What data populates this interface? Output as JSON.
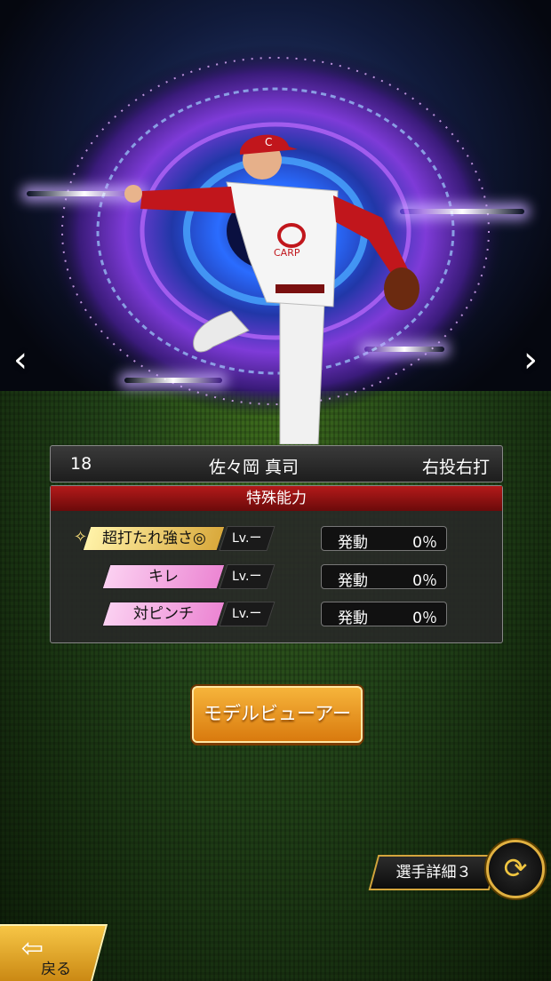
{
  "player": {
    "number": "18",
    "name": "佐々岡 真司",
    "throw_bat": "右投右打",
    "cap_logo": "C",
    "jersey_text": "CARP"
  },
  "abilities": {
    "header": "特殊能力",
    "items": [
      {
        "name": "超打たれ強さ◎",
        "prefix_icon": "sparkle-icon",
        "level": "Lv.ー",
        "status": "発動",
        "percent": "0％",
        "color": "#e9c45a"
      },
      {
        "name": "キレ",
        "prefix_icon": "",
        "level": "Lv.ー",
        "status": "発動",
        "percent": "0％",
        "color": "#f08fd8"
      },
      {
        "name": "対ピンチ",
        "prefix_icon": "",
        "level": "Lv.ー",
        "status": "発動",
        "percent": "0％",
        "color": "#f08fd8"
      }
    ]
  },
  "buttons": {
    "model_viewer": "モデルビューアー",
    "player_detail": "選手詳細３",
    "back": "戻る"
  },
  "nav": {
    "prev": "‹",
    "next": "›"
  },
  "colors": {
    "accent_red": "#b41a1a",
    "button_orange": "#e8941f",
    "gold": "#e0b040"
  }
}
